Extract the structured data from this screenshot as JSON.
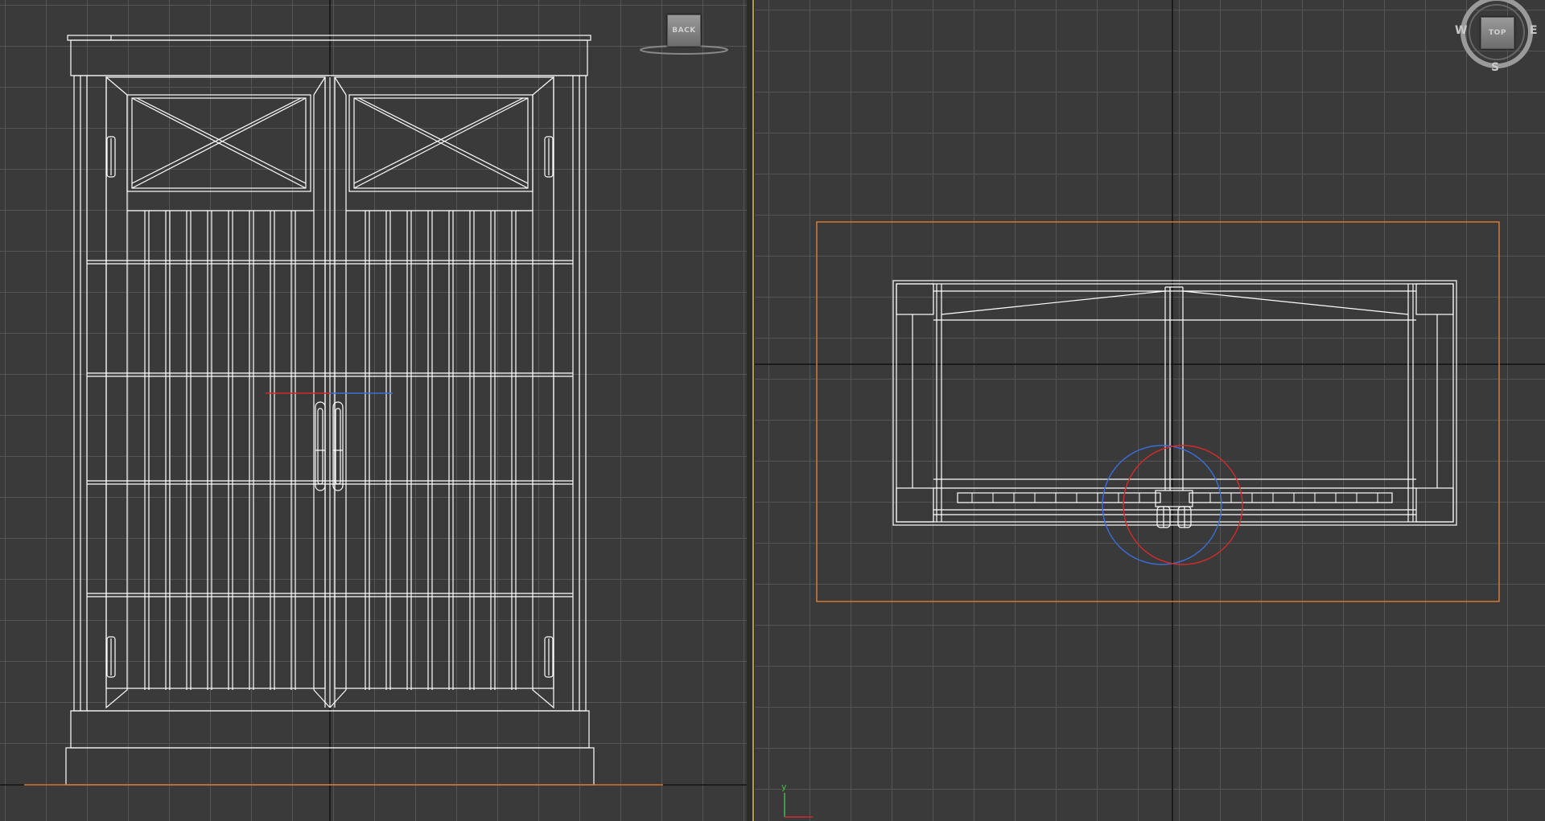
{
  "viewports": {
    "back": {
      "name": "Back",
      "viewcube_label": "BACK"
    },
    "top": {
      "name": "Top",
      "viewcube_label": "TOP",
      "compass": {
        "west": "W",
        "east": "E",
        "south": "S"
      },
      "axis": {
        "y": "y"
      }
    }
  },
  "colors": {
    "grid": "#555555",
    "background": "#3a3a3a",
    "wire": "#ffffff",
    "selection": "#d9772e",
    "gizmo_x": "#d22b2b",
    "gizmo_z": "#3a6ed8",
    "axis_y": "#3fbf3f",
    "active_border": "#b89b3a"
  }
}
